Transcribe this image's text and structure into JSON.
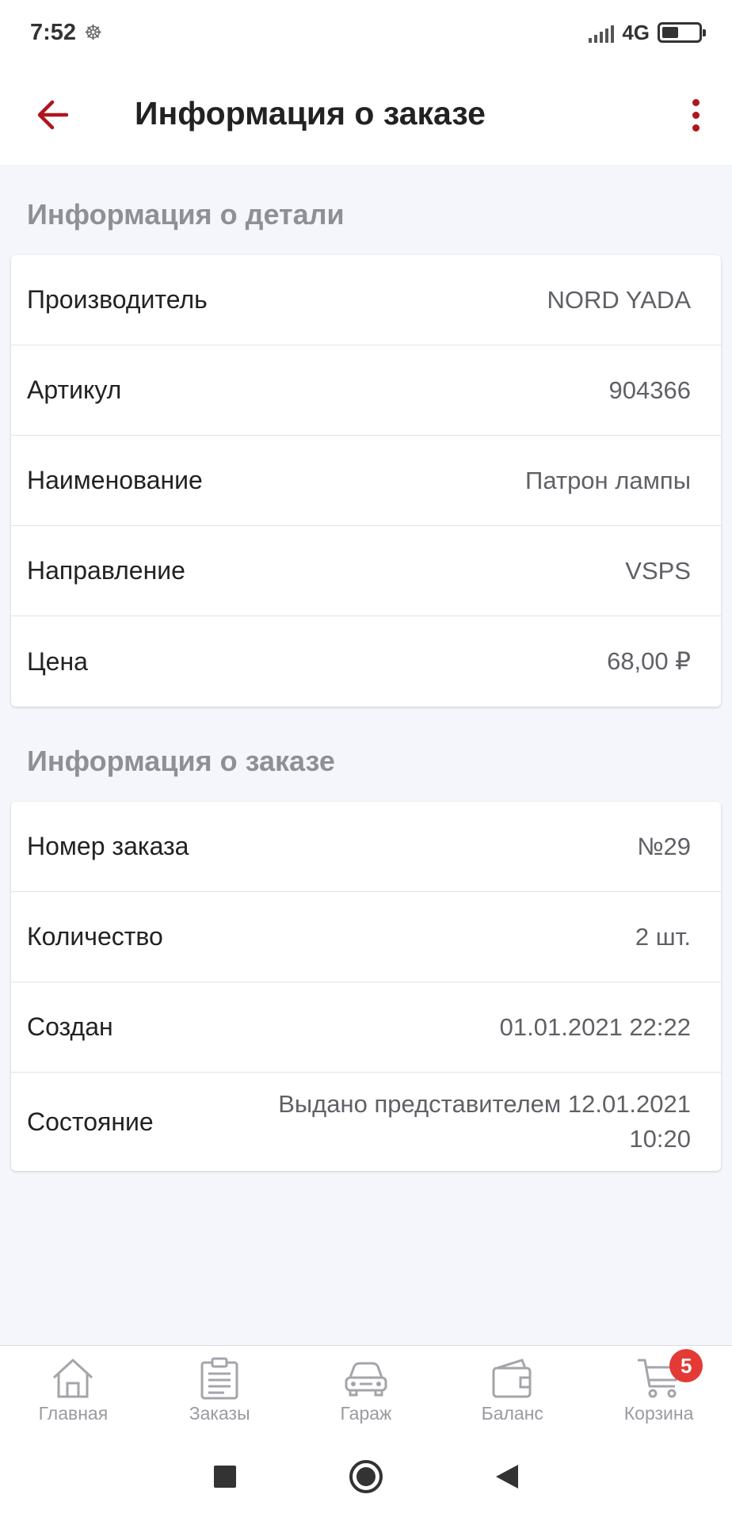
{
  "status_bar": {
    "time": "7:52",
    "network": "4G"
  },
  "app_bar": {
    "title": "Информация о заказе",
    "accent_color": "#b0151e"
  },
  "part_section": {
    "title": "Информация о детали",
    "rows": [
      {
        "label": "Производитель",
        "value": "NORD YADA"
      },
      {
        "label": "Артикул",
        "value": "904366"
      },
      {
        "label": "Наименование",
        "value": "Патрон лампы"
      },
      {
        "label": "Направление",
        "value": "VSPS"
      },
      {
        "label": "Цена",
        "value": "68,00 ₽"
      }
    ]
  },
  "order_section": {
    "title": "Информация о заказе",
    "rows": [
      {
        "label": "Номер заказа",
        "value": "№29"
      },
      {
        "label": "Количество",
        "value": "2 шт."
      },
      {
        "label": "Создан",
        "value": "01.01.2021 22:22"
      },
      {
        "label": "Состояние",
        "value": "Выдано представителем 12.01.2021 10:20"
      }
    ]
  },
  "bottom_nav": {
    "items": [
      {
        "label": "Главная",
        "icon": "home-icon"
      },
      {
        "label": "Заказы",
        "icon": "clipboard-icon"
      },
      {
        "label": "Гараж",
        "icon": "car-icon"
      },
      {
        "label": "Баланс",
        "icon": "wallet-icon"
      },
      {
        "label": "Корзина",
        "icon": "cart-icon"
      }
    ],
    "cart_badge": "5",
    "badge_color": "#e53935"
  }
}
